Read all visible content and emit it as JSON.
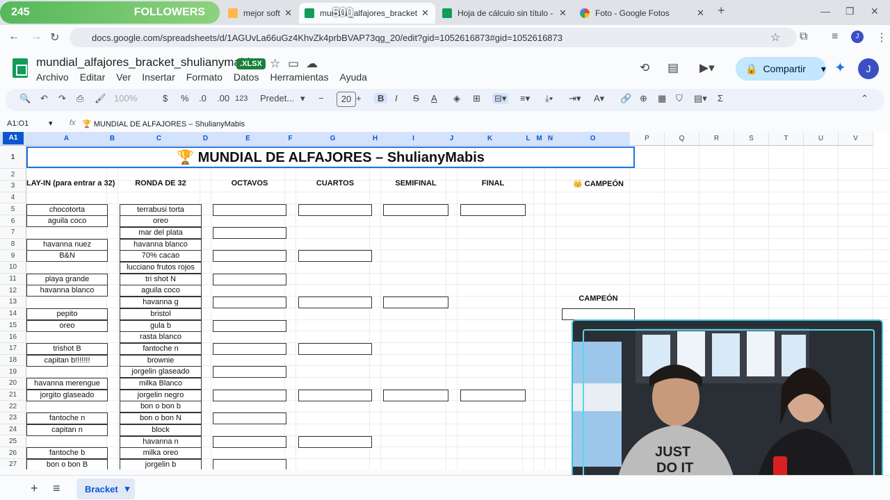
{
  "overlay": {
    "left_count": "245",
    "left_label": "FOLLOWERS",
    "right_count": "500"
  },
  "tabs": [
    {
      "label": "mejor software para"
    },
    {
      "label": "mundial_alfajores_bracket_shu"
    },
    {
      "label": "Hoja de cálculo sin título - Hoja"
    },
    {
      "label": "Foto - Google Fotos"
    }
  ],
  "address": {
    "url": "docs.google.com/spreadsheets/d/1AGUvLa66uGz4KhvZk4prbBVAP73qg_20/edit?gid=1052616873#gid=1052616873"
  },
  "doc": {
    "title": "mundial_alfajores_bracket_shulianymabis",
    "badge": ".XLSX",
    "menu": [
      "Archivo",
      "Editar",
      "Ver",
      "Insertar",
      "Formato",
      "Datos",
      "Herramientas",
      "Ayuda"
    ],
    "share_label": "Compartir",
    "avatar_letter": "J"
  },
  "toolbar": {
    "zoom": "100%",
    "currency": "$",
    "percent": "%",
    "dec_less": ".0",
    "dec_more": ".00",
    "number_format": "123",
    "font": "Predet...",
    "minus": "−",
    "font_size": "20",
    "plus": "+",
    "bold": "B",
    "italic": "I",
    "strike": "S",
    "text_color": "A"
  },
  "formula_bar": {
    "namebox": "A1:O1",
    "fx": "fx",
    "value": "🏆 MUNDIAL DE ALFAJORES – ShulianyMabis"
  },
  "columns": [
    "A",
    "B",
    "C",
    "D",
    "E",
    "F",
    "G",
    "H",
    "I",
    "J",
    "K",
    "L",
    "M",
    "N",
    "O",
    "P",
    "Q",
    "R",
    "S",
    "T",
    "U",
    "V"
  ],
  "select_all": "A1",
  "rows": [
    "1",
    "2",
    "3",
    "4",
    "5",
    "6",
    "7",
    "8",
    "9",
    "10",
    "11",
    "12",
    "13",
    "14",
    "15",
    "16",
    "17",
    "18",
    "19",
    "20",
    "21",
    "22",
    "23",
    "24",
    "25",
    "26",
    "27"
  ],
  "sheet": {
    "title": "🏆  MUNDIAL DE ALFAJORES – ShulianyMabis",
    "headers": {
      "play_in": "LAY-IN (para entrar a 32)",
      "ronda32": "RONDA DE 32",
      "octavos": "OCTAVOS",
      "cuartos": "CUARTOS",
      "semifinal": "SEMIFINAL",
      "final": "FINAL",
      "campeon": "👑 CAMPEÓN",
      "campeon2": "CAMPEÓN"
    },
    "play_in": [
      {
        "row": 5,
        "text": "chocotorta"
      },
      {
        "row": 6,
        "text": "aguila coco"
      },
      {
        "row": 8,
        "text": "havanna nuez"
      },
      {
        "row": 9,
        "text": "B&N"
      },
      {
        "row": 11,
        "text": "playa grande"
      },
      {
        "row": 12,
        "text": "havanna blanco"
      },
      {
        "row": 14,
        "text": "pepito"
      },
      {
        "row": 15,
        "text": "oreo"
      },
      {
        "row": 17,
        "text": "trishot B"
      },
      {
        "row": 18,
        "text": "capitan b!!!!!!!"
      },
      {
        "row": 20,
        "text": "havanna merengue"
      },
      {
        "row": 21,
        "text": "jorgito glaseado"
      },
      {
        "row": 23,
        "text": "fantoche n"
      },
      {
        "row": 24,
        "text": "capitan n"
      },
      {
        "row": 26,
        "text": "fantoche b"
      },
      {
        "row": 27,
        "text": "bon o bon B"
      }
    ],
    "ronda32": [
      "terrabusi torta",
      "oreo",
      "mar del plata",
      "havanna blanco",
      "70% cacao",
      "lucciano frutos rojos",
      "tri shot N",
      "aguila coco",
      "havanna g",
      "bristol",
      "gula b",
      "rasta blanco",
      "fantoche n",
      "brownie",
      "jorgelin glaseado",
      "milka Blanco",
      "jorgelin negro",
      "bon o bon b",
      "bon o bon N",
      "block",
      "havanna n",
      "milka oreo",
      "jorgelin b"
    ]
  },
  "bottom": {
    "add": "+",
    "list": "≡",
    "sheet_tab": "Bracket"
  }
}
